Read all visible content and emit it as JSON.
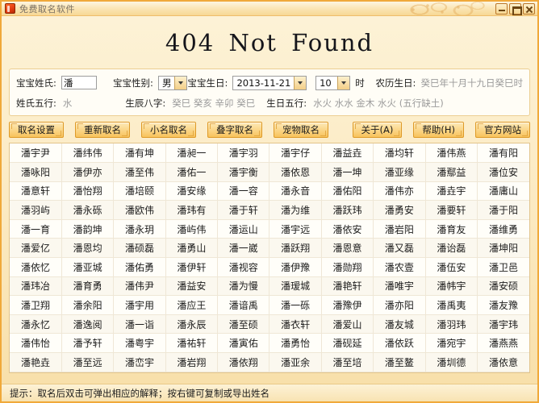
{
  "window": {
    "title": "免费取名软件",
    "icon": "app-icon",
    "minimize_label": "最小化",
    "maximize_label": "最大化",
    "close_label": "关闭"
  },
  "heading": "404  Not  Found",
  "form": {
    "surname_label": "宝宝姓氏:",
    "surname_value": "潘",
    "gender_label": "宝宝性别:",
    "gender_value": "男",
    "birthday_label": "宝宝生日:",
    "birthday_value": "2013-11-21",
    "hour_value": "10",
    "hour_unit": "时",
    "lunar_label": "农历生日:",
    "lunar_value": "癸巳年十月十九日癸巳时",
    "surname_wuxing_label": "姓氏五行:",
    "surname_wuxing_value": "水",
    "bazi_label": "生辰八字:",
    "bazi_value": "癸巳 癸亥 辛卯 癸巳",
    "birth_wuxing_label": "生日五行:",
    "birth_wuxing_value": "水火 水水 金木 水火 (五行缺土)"
  },
  "buttons": {
    "left": [
      {
        "label": "取名设置",
        "name": "naming-settings-button"
      },
      {
        "label": "重新取名",
        "name": "rename-button"
      },
      {
        "label": "小名取名",
        "name": "nickname-button"
      },
      {
        "label": "叠字取名",
        "name": "reduplicated-name-button"
      },
      {
        "label": "宠物取名",
        "name": "pet-name-button"
      }
    ],
    "right": [
      {
        "label": "关于(A)",
        "name": "about-button"
      },
      {
        "label": "帮助(H)",
        "name": "help-button"
      },
      {
        "label": "官方网站",
        "name": "official-website-button"
      }
    ]
  },
  "name_grid": {
    "columns": 10,
    "rows": [
      [
        "潘宇尹",
        "潘纬伟",
        "潘有坤",
        "潘昶一",
        "潘宇羽",
        "潘宇仔",
        "潘益垚",
        "潘均轩",
        "潘伟燕",
        "潘有阳"
      ],
      [
        "潘咏阳",
        "潘伊亦",
        "潘至伟",
        "潘佑一",
        "潘宇衡",
        "潘依恩",
        "潘一坤",
        "潘亚缘",
        "潘鄢益",
        "潘位安"
      ],
      [
        "潘意轩",
        "潘怡翔",
        "潘培颐",
        "潘安缘",
        "潘一容",
        "潘永音",
        "潘佑阳",
        "潘伟亦",
        "潘垚宇",
        "潘庸山"
      ],
      [
        "潘羽屿",
        "潘永砾",
        "潘欧伟",
        "潘玮有",
        "潘于轩",
        "潘为维",
        "潘跃玮",
        "潘勇安",
        "潘要轩",
        "潘于阳"
      ],
      [
        "潘一育",
        "潘韵坤",
        "潘永玥",
        "潘屿伟",
        "潘运山",
        "潘宇远",
        "潘依安",
        "潘岩阳",
        "潘育友",
        "潘维勇"
      ],
      [
        "潘爱亿",
        "潘恩均",
        "潘硕磊",
        "潘勇山",
        "潘一崴",
        "潘跃翔",
        "潘恩意",
        "潘又磊",
        "潘诒磊",
        "潘坤阳"
      ],
      [
        "潘依忆",
        "潘亚城",
        "潘佑勇",
        "潘伊轩",
        "潘视容",
        "潘伊豫",
        "潘勋翔",
        "潘农壹",
        "潘伍安",
        "潘卫邑"
      ],
      [
        "潘玮冶",
        "潘育勇",
        "潘伟尹",
        "潘益安",
        "潘为慢",
        "潘瑷城",
        "潘艳轩",
        "潘唯宇",
        "潘帏宇",
        "潘安硕"
      ],
      [
        "潘卫翔",
        "潘余阳",
        "潘宇用",
        "潘应王",
        "潘谙禹",
        "潘一砾",
        "潘豫伊",
        "潘亦阳",
        "潘禹夷",
        "潘友豫"
      ],
      [
        "潘永忆",
        "潘逸阅",
        "潘一诣",
        "潘永辰",
        "潘至硕",
        "潘衣轩",
        "潘爱山",
        "潘友城",
        "潘羽玮",
        "潘宇玮"
      ],
      [
        "潘伟怡",
        "潘予轩",
        "潘粤宇",
        "潘祐轩",
        "潘寅佑",
        "潘勇怡",
        "潘砚延",
        "潘依跃",
        "潘宛宇",
        "潘燕燕"
      ],
      [
        "潘艳垚",
        "潘至远",
        "潘峦宇",
        "潘岩翔",
        "潘依翔",
        "潘亚余",
        "潘至培",
        "潘至鳌",
        "潘圳德",
        "潘依意"
      ]
    ]
  },
  "statusbar": {
    "text": "提示：取名后双击可弹出相应的解释；按右键可复制或导出姓名"
  },
  "colors": {
    "accent": "#f0a93a",
    "panel": "#fffdf6",
    "button": "#fbd88e"
  }
}
